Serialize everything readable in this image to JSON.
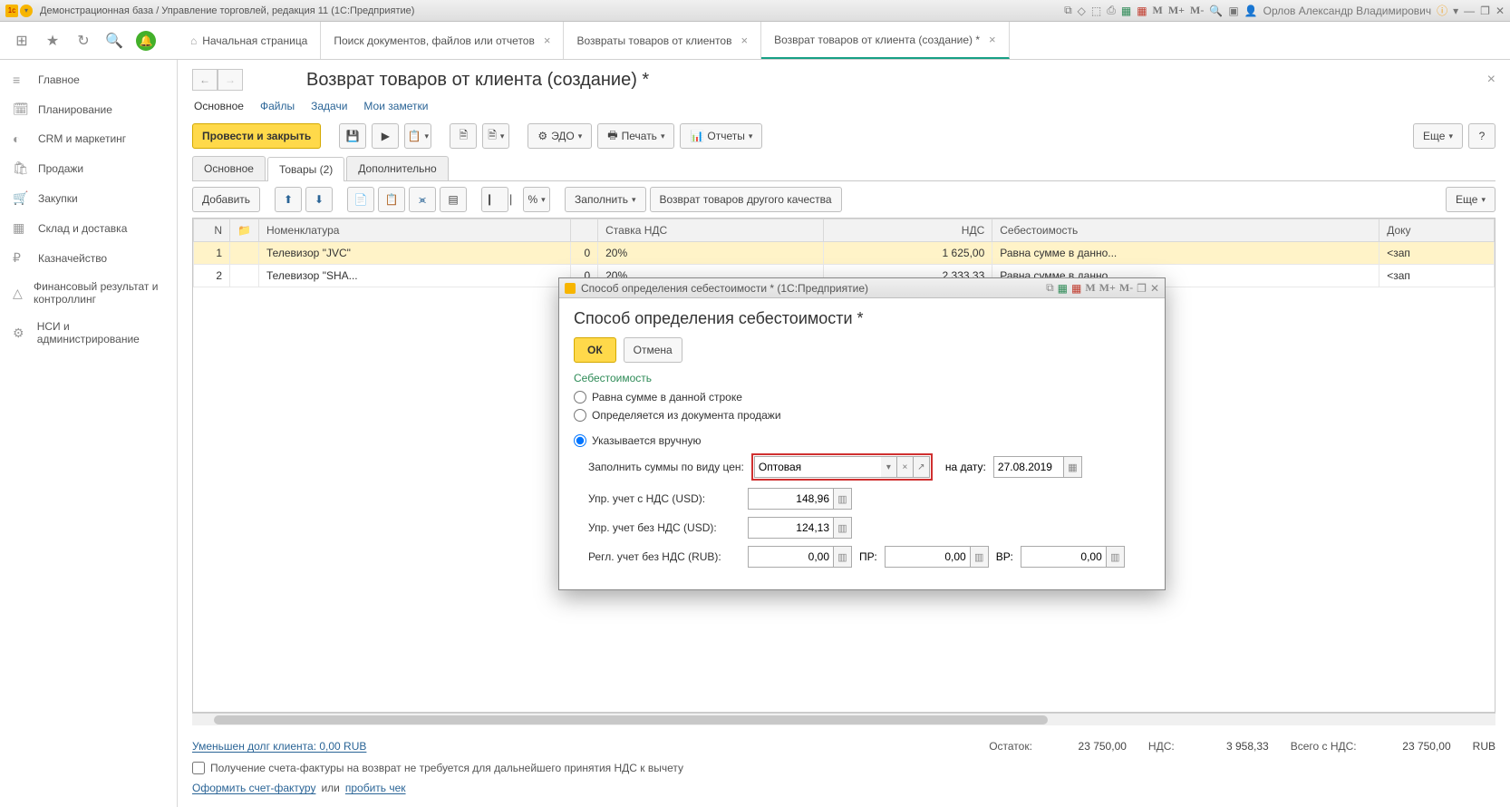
{
  "title_bar": {
    "text": "Демонстрационная база / Управление торговлей, редакция 11  (1С:Предприятие)",
    "user": "Орлов Александр Владимирович",
    "m_labels": [
      "M",
      "M+",
      "M-"
    ]
  },
  "app_tabs": {
    "home": "Начальная страница",
    "items": [
      {
        "label": "Поиск документов, файлов или отчетов"
      },
      {
        "label": "Возвраты товаров от клиентов"
      },
      {
        "label": "Возврат товаров от клиента (создание) *",
        "active": true
      }
    ]
  },
  "sidebar": {
    "items": [
      {
        "label": "Главное",
        "icon": "≡"
      },
      {
        "label": "Планирование",
        "icon": "🗓"
      },
      {
        "label": "CRM и маркетинг",
        "icon": "◐"
      },
      {
        "label": "Продажи",
        "icon": "🛍"
      },
      {
        "label": "Закупки",
        "icon": "🛒"
      },
      {
        "label": "Склад и доставка",
        "icon": "▦"
      },
      {
        "label": "Казначейство",
        "icon": "₽"
      },
      {
        "label": "Финансовый результат и контроллинг",
        "icon": "△"
      },
      {
        "label": "НСИ и администрирование",
        "icon": "⚙"
      }
    ]
  },
  "page": {
    "title": "Возврат товаров от клиента (создание) *",
    "subtabs": {
      "main": "Основное",
      "files": "Файлы",
      "tasks": "Задачи",
      "notes": "Мои заметки"
    },
    "buttons": {
      "post_close": "Провести и закрыть",
      "edo": "ЭДО",
      "print": "Печать",
      "reports": "Отчеты",
      "more": "Еще",
      "help": "?"
    },
    "doc_tabs": {
      "main": "Основное",
      "goods": "Товары (2)",
      "extra": "Дополнительно"
    },
    "goods_toolbar": {
      "add": "Добавить",
      "fill": "Заполнить",
      "other_quality": "Возврат товаров другого качества",
      "more": "Еще"
    },
    "table": {
      "headers": {
        "n": "N",
        "nomen": "Номенклатура",
        "vat_rate": "Ставка НДС",
        "vat": "НДС",
        "cost": "Себестоимость",
        "doc": "Доку"
      },
      "rows": [
        {
          "n": "1",
          "nomen": "Телевизор \"JVC\"",
          "extra_num": "0",
          "vat_rate": "20%",
          "vat": "1 625,00",
          "cost": "Равна сумме в данно...",
          "doc": "<зап"
        },
        {
          "n": "2",
          "nomen": "Телевизор \"SHA...",
          "extra_num": "0",
          "vat_rate": "20%",
          "vat": "2 333,33",
          "cost": "Равна сумме в данно...",
          "doc": "<зап"
        }
      ]
    },
    "footer": {
      "debt_link": "Уменьшен долг клиента: 0,00 RUB",
      "balance_label": "Остаток:",
      "balance": "23 750,00",
      "vat_label": "НДС:",
      "vat": "3 958,33",
      "total_label": "Всего с НДС:",
      "total": "23 750,00",
      "currency": "RUB",
      "receipt_chk": "Получение счета-фактуры на возврат не требуется для дальнейшего принятия НДС к вычету",
      "invoice_link": "Оформить счет-фактуру",
      "or": " или ",
      "check_link": "пробить чек"
    }
  },
  "modal": {
    "title": "Способ определения себестоимости *  (1С:Предприятие)",
    "heading": "Способ определения себестоимости *",
    "ok": "ОК",
    "cancel": "Отмена",
    "section": "Себестоимость",
    "radios": {
      "r1": "Равна сумме в данной строке",
      "r2": "Определяется из документа продажи",
      "r3": "Указывается вручную"
    },
    "price_type_label": "Заполнить суммы по виду цен:",
    "price_type_value": "Оптовая",
    "date_label": "на дату:",
    "date_value": "27.08.2019",
    "fields": {
      "f1_label": "Упр. учет с НДС (USD):",
      "f1_value": "148,96",
      "f2_label": "Упр. учет без НДС (USD):",
      "f2_value": "124,13",
      "f3_label": "Регл. учет без НДС (RUB):",
      "f3_value": "0,00",
      "pr_label": "ПР:",
      "pr_value": "0,00",
      "vr_label": "ВР:",
      "vr_value": "0,00"
    },
    "m_labels": [
      "M",
      "M+",
      "M-"
    ]
  }
}
